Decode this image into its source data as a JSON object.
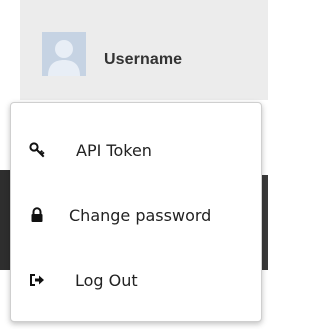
{
  "user": {
    "username": "Username",
    "avatar_icon": "default-avatar-icon"
  },
  "menu": {
    "items": [
      {
        "label": "API Token",
        "icon": "key-icon"
      },
      {
        "label": "Change password",
        "icon": "lock-icon"
      },
      {
        "label": "Log Out",
        "icon": "sign-out-icon"
      }
    ]
  },
  "colors": {
    "header_bg": "#ececec",
    "avatar_bg": "#c6d3e3",
    "text": "#222222",
    "menu_border": "#cfcfcf"
  }
}
